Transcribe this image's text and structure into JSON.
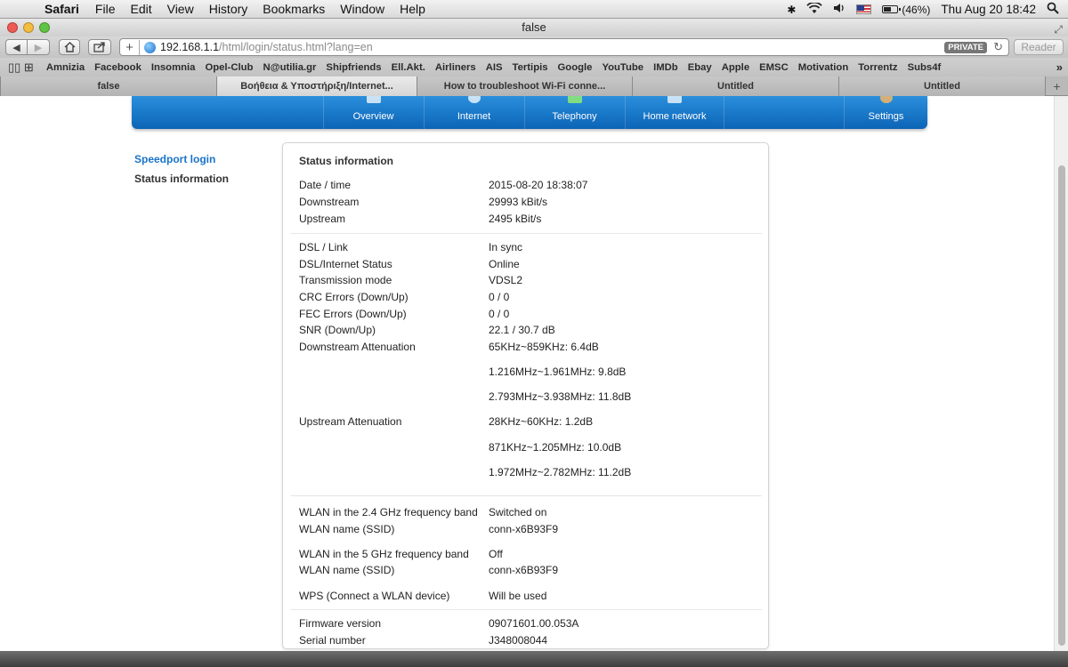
{
  "menubar": {
    "app": "Safari",
    "items": [
      "File",
      "Edit",
      "View",
      "History",
      "Bookmarks",
      "Window",
      "Help"
    ],
    "battery": "(46%)",
    "clock": "Thu Aug 20  18:42"
  },
  "window": {
    "title": "false"
  },
  "toolbar": {
    "url_host": "192.168.1.1",
    "url_path": "/html/login/status.html?lang=en",
    "private_label": "PRIVATE",
    "reader_label": "Reader"
  },
  "bookmarks": [
    "Amnizia",
    "Facebook",
    "Insomnia",
    "Opel-Club",
    "N@utilia.gr",
    "Shipfriends",
    "Ell.Akt.",
    "Airliners",
    "AIS",
    "Tertipis",
    "Google",
    "YouTube",
    "IMDb",
    "Ebay",
    "Apple",
    "EMSC",
    "Motivation",
    "Torrentz",
    "Subs4f"
  ],
  "tabs": [
    "false",
    "Βοήθεια & Υποστήριξη/Internet...",
    "How to troubleshoot Wi-Fi conne...",
    "Untitled",
    "Untitled"
  ],
  "nav": {
    "overview": "Overview",
    "internet": "Internet",
    "telephony": "Telephony",
    "home_network": "Home network",
    "settings": "Settings"
  },
  "sidebar": {
    "login": "Speedport login",
    "status": "Status information"
  },
  "panel": {
    "title": "Status information",
    "rows": [
      {
        "label": "Date / time",
        "value": "2015-08-20 18:38:07"
      },
      {
        "label": "Downstream",
        "value": "29993 kBit/s"
      },
      {
        "label": "Upstream",
        "value": "2495 kBit/s"
      },
      {
        "label": "DSL / Link",
        "value": "In sync"
      },
      {
        "label": "DSL/Internet Status",
        "value": "Online"
      },
      {
        "label": "Transmission mode",
        "value": "VDSL2"
      },
      {
        "label": "CRC Errors (Down/Up)",
        "value": "0 / 0"
      },
      {
        "label": "FEC Errors (Down/Up)",
        "value": "0 / 0"
      },
      {
        "label": "SNR (Down/Up)",
        "value": "22.1 / 30.7 dB"
      },
      {
        "label": "Downstream Attenuation",
        "value": "65KHz~859KHz: 6.4dB"
      },
      {
        "label": "",
        "value": "1.216MHz~1.961MHz: 9.8dB"
      },
      {
        "label": "",
        "value": "2.793MHz~3.938MHz: 11.8dB"
      },
      {
        "label": "Upstream Attenuation",
        "value": "28KHz~60KHz: 1.2dB"
      },
      {
        "label": "",
        "value": "871KHz~1.205MHz: 10.0dB"
      },
      {
        "label": "",
        "value": "1.972MHz~2.782MHz: 11.2dB"
      },
      {
        "label": "WLAN in the 2.4 GHz frequency band",
        "value": "Switched on"
      },
      {
        "label": "WLAN name (SSID)",
        "value": "conn-x6B93F9"
      },
      {
        "label": "WLAN in the 5 GHz frequency band",
        "value": "Off"
      },
      {
        "label": "WLAN name (SSID)",
        "value": "conn-x6B93F9"
      },
      {
        "label": "WPS (Connect a WLAN device)",
        "value": "Will be used"
      },
      {
        "label": "Firmware version",
        "value": "09071601.00.053A"
      },
      {
        "label": "Serial number",
        "value": "J348008044"
      }
    ]
  }
}
